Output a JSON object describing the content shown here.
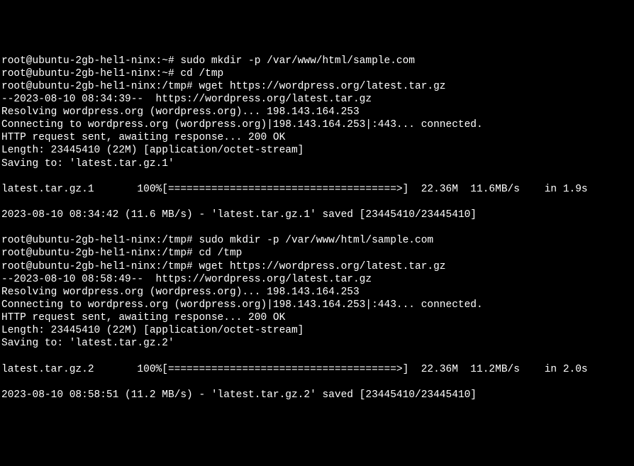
{
  "lines": {
    "l1_prompt": "root@ubuntu-2gb-hel1-ninx:~#",
    "l1_cmd": " sudo mkdir -p /var/www/html/sample.com",
    "l2_prompt": "root@ubuntu-2gb-hel1-ninx:~#",
    "l2_cmd": " cd /tmp",
    "l3_prompt": "root@ubuntu-2gb-hel1-ninx:/tmp#",
    "l3_cmd": " wget https://wordpress.org/latest.tar.gz",
    "l4": "--2023-08-10 08:34:39--  https://wordpress.org/latest.tar.gz",
    "l5": "Resolving wordpress.org (wordpress.org)... 198.143.164.253",
    "l6": "Connecting to wordpress.org (wordpress.org)|198.143.164.253|:443... connected.",
    "l7": "HTTP request sent, awaiting response... 200 OK",
    "l8": "Length: 23445410 (22M) [application/octet-stream]",
    "l9": "Saving to: 'latest.tar.gz.1'",
    "l10": "latest.tar.gz.1       100%[=====================================>]  22.36M  11.6MB/s    in 1.9s",
    "l11": "2023-08-10 08:34:42 (11.6 MB/s) - 'latest.tar.gz.1' saved [23445410/23445410]",
    "l12_prompt": "root@ubuntu-2gb-hel1-ninx:/tmp#",
    "l12_cmd": " sudo mkdir -p /var/www/html/sample.com",
    "l13_prompt": "root@ubuntu-2gb-hel1-ninx:/tmp#",
    "l13_cmd": " cd /tmp",
    "l14_prompt": "root@ubuntu-2gb-hel1-ninx:/tmp#",
    "l14_cmd": " wget https://wordpress.org/latest.tar.gz",
    "l15": "--2023-08-10 08:58:49--  https://wordpress.org/latest.tar.gz",
    "l16": "Resolving wordpress.org (wordpress.org)... 198.143.164.253",
    "l17": "Connecting to wordpress.org (wordpress.org)|198.143.164.253|:443... connected.",
    "l18": "HTTP request sent, awaiting response... 200 OK",
    "l19": "Length: 23445410 (22M) [application/octet-stream]",
    "l20": "Saving to: 'latest.tar.gz.2'",
    "l21": "latest.tar.gz.2       100%[=====================================>]  22.36M  11.2MB/s    in 2.0s",
    "l22": "2023-08-10 08:58:51 (11.2 MB/s) - 'latest.tar.gz.2' saved [23445410/23445410]"
  }
}
